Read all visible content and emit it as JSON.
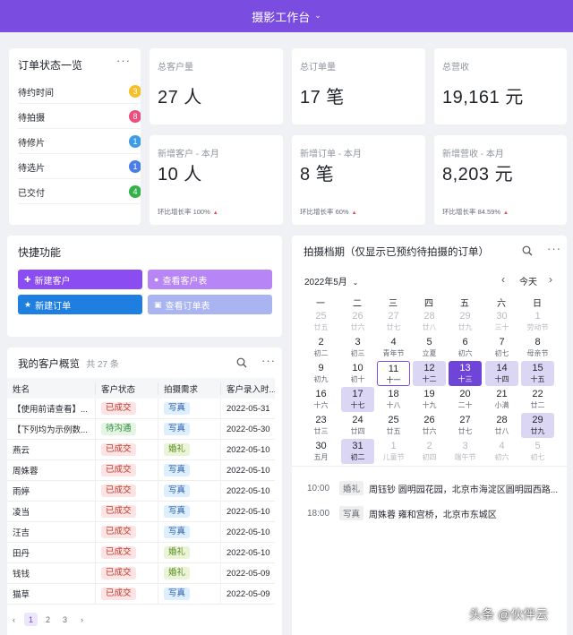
{
  "header": {
    "title": "摄影工作台"
  },
  "status_card": {
    "title": "订单状态一览",
    "more": "···",
    "rows": [
      {
        "label": "待约时间",
        "count": "3",
        "color": "#f7c028"
      },
      {
        "label": "待拍摄",
        "count": "8",
        "color": "#ee4d7d"
      },
      {
        "label": "待修片",
        "count": "1",
        "color": "#3d9be8"
      },
      {
        "label": "待选片",
        "count": "1",
        "color": "#4a7de8"
      },
      {
        "label": "已交付",
        "count": "4",
        "color": "#34b24a"
      }
    ]
  },
  "stats": [
    {
      "label": "总客户量",
      "value": "27 人"
    },
    {
      "label": "总订单量",
      "value": "17 笔"
    },
    {
      "label": "总营收",
      "value": "19,161 元"
    },
    {
      "label": "新增客户 - 本月",
      "value": "10 人",
      "growth": "环比增长率 100%"
    },
    {
      "label": "新增订单 - 本月",
      "value": "8 笔",
      "growth": "环比增长率 60%"
    },
    {
      "label": "新增营收 - 本月",
      "value": "8,203 元",
      "growth": "环比增长率 84.59%"
    }
  ],
  "quick": {
    "title": "快捷功能",
    "buttons": [
      {
        "label": "新建客户",
        "color": "#8b4cf2"
      },
      {
        "label": "查看客户表",
        "color": "#b785f5"
      },
      {
        "label": "新建订单",
        "color": "#1e7fe0"
      },
      {
        "label": "查看订单表",
        "color": "#a9b4f0"
      }
    ]
  },
  "customers": {
    "title": "我的客户概览",
    "count": "共 27 条",
    "headers": [
      "姓名",
      "客户状态",
      "拍摄需求",
      "客户录入时..."
    ],
    "rows": [
      [
        "【使用前请查看】...",
        "已成交",
        "写真",
        "2022-05-31"
      ],
      [
        "【下列均为示例数...",
        "待沟通",
        "写真",
        "2022-05-30"
      ],
      [
        "燕云",
        "已成交",
        "婚礼",
        "2022-05-10"
      ],
      [
        "周姝蓉",
        "已成交",
        "写真",
        "2022-05-10"
      ],
      [
        "雨婷",
        "已成交",
        "写真",
        "2022-05-10"
      ],
      [
        "凌当",
        "已成交",
        "写真",
        "2022-05-10"
      ],
      [
        "汪吉",
        "已成交",
        "写真",
        "2022-05-10"
      ],
      [
        "田丹",
        "已成交",
        "婚礼",
        "2022-05-10"
      ],
      [
        "钱钱",
        "已成交",
        "婚礼",
        "2022-05-09"
      ],
      [
        "猫草",
        "已成交",
        "写真",
        "2022-05-09"
      ]
    ],
    "pages": [
      "1",
      "2",
      "3"
    ]
  },
  "schedule": {
    "title": "拍摄档期（仅显示已预约待拍摄的订单）",
    "month": "2022年5月",
    "today_label": "今天",
    "weekdays": [
      "一",
      "二",
      "三",
      "四",
      "五",
      "六",
      "日"
    ],
    "days": [
      [
        "25",
        "廿五",
        "dim"
      ],
      [
        "26",
        "廿六",
        "dim"
      ],
      [
        "27",
        "廿七",
        "dim"
      ],
      [
        "28",
        "廿八",
        "dim"
      ],
      [
        "29",
        "廿九",
        "dim"
      ],
      [
        "30",
        "三十",
        "dim"
      ],
      [
        "1",
        "劳动节",
        "dim"
      ],
      [
        "2",
        "初二",
        "norm"
      ],
      [
        "3",
        "初三",
        "norm"
      ],
      [
        "4",
        "青年节",
        "norm"
      ],
      [
        "5",
        "立夏",
        "norm"
      ],
      [
        "6",
        "初六",
        "norm"
      ],
      [
        "7",
        "初七",
        "norm"
      ],
      [
        "8",
        "母亲节",
        "norm"
      ],
      [
        "9",
        "初九",
        "norm"
      ],
      [
        "10",
        "初十",
        "norm"
      ],
      [
        "11",
        "十一",
        "today"
      ],
      [
        "12",
        "十二",
        "hl"
      ],
      [
        "13",
        "十三",
        "sel"
      ],
      [
        "14",
        "十四",
        "hl"
      ],
      [
        "15",
        "十五",
        "hl"
      ],
      [
        "16",
        "十六",
        "norm"
      ],
      [
        "17",
        "十七",
        "hl"
      ],
      [
        "18",
        "十八",
        "norm"
      ],
      [
        "19",
        "十九",
        "norm"
      ],
      [
        "20",
        "二十",
        "norm"
      ],
      [
        "21",
        "小满",
        "norm"
      ],
      [
        "22",
        "廿二",
        "norm"
      ],
      [
        "23",
        "廿三",
        "norm"
      ],
      [
        "24",
        "廿四",
        "norm"
      ],
      [
        "25",
        "廿五",
        "norm"
      ],
      [
        "26",
        "廿六",
        "norm"
      ],
      [
        "27",
        "廿七",
        "norm"
      ],
      [
        "28",
        "廿八",
        "norm"
      ],
      [
        "29",
        "廿九",
        "hl"
      ],
      [
        "30",
        "五月",
        "norm"
      ],
      [
        "31",
        "初二",
        "hl"
      ],
      [
        "1",
        "儿童节",
        "dim"
      ],
      [
        "2",
        "初四",
        "dim"
      ],
      [
        "3",
        "端午节",
        "dim"
      ],
      [
        "4",
        "初六",
        "dim"
      ],
      [
        "5",
        "初七",
        "dim"
      ]
    ],
    "events": [
      {
        "time": "10:00",
        "type": "婚礼",
        "text": "周钰钞 圆明园花园，北京市海淀区圆明园西路..."
      },
      {
        "time": "18:00",
        "type": "写真",
        "text": "周姝蓉 雍和宫桥，北京市东城区"
      }
    ]
  },
  "watermark": "头条 @伙伴云"
}
